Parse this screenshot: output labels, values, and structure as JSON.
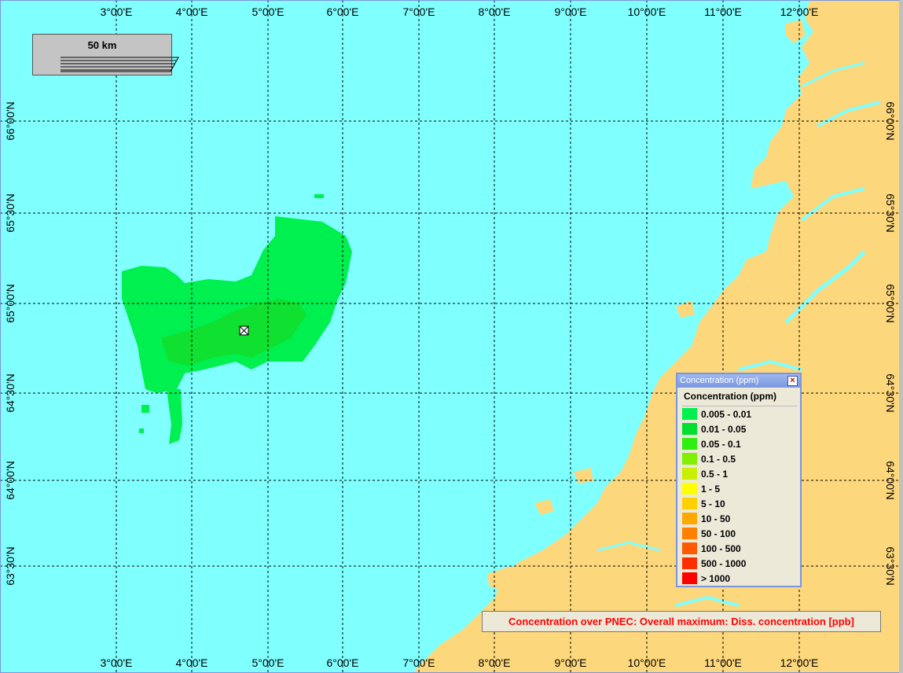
{
  "map": {
    "lon_labels": [
      "3°00'E",
      "4°00'E",
      "5°00'E",
      "6°00'E",
      "7°00'E",
      "8°00'E",
      "9°00'E",
      "10°00'E",
      "11°00'E",
      "12°00'E"
    ],
    "lat_labels": [
      "66°00'N",
      "65°30'N",
      "65°00'N",
      "64°30'N",
      "64°00'N",
      "63°30'N"
    ],
    "colors": {
      "sea": "#80ffff",
      "land": "#fcd77c",
      "grid": "#000000",
      "plume_outer": "#00f050",
      "plume_inner": "#10e030"
    },
    "source_marker_icon": "release-point-icon"
  },
  "scalebar": {
    "label": "50 km"
  },
  "legend": {
    "window_title": "Concentration (ppm)",
    "heading": "Concentration (ppm)",
    "close_icon": "close-icon",
    "items": [
      {
        "label": "0.005 - 0.01",
        "color": "#00f050"
      },
      {
        "label": "0.01 - 0.05",
        "color": "#00e030"
      },
      {
        "label": "0.05 - 0.1",
        "color": "#30ee10"
      },
      {
        "label": "0.1 - 0.5",
        "color": "#80f000"
      },
      {
        "label": "0.5 - 1",
        "color": "#c8f000"
      },
      {
        "label": "1 - 5",
        "color": "#ffff00"
      },
      {
        "label": "5 - 10",
        "color": "#ffd000"
      },
      {
        "label": "10 - 50",
        "color": "#ffa800"
      },
      {
        "label": "50 - 100",
        "color": "#ff8000"
      },
      {
        "label": "100 - 500",
        "color": "#ff5a00"
      },
      {
        "label": "500 - 1000",
        "color": "#ff3000"
      },
      {
        "label": "> 1000",
        "color": "#ff0000"
      }
    ]
  },
  "caption": {
    "text": "Concentration over PNEC: Overall maximum: Diss. concentration [ppb]"
  }
}
